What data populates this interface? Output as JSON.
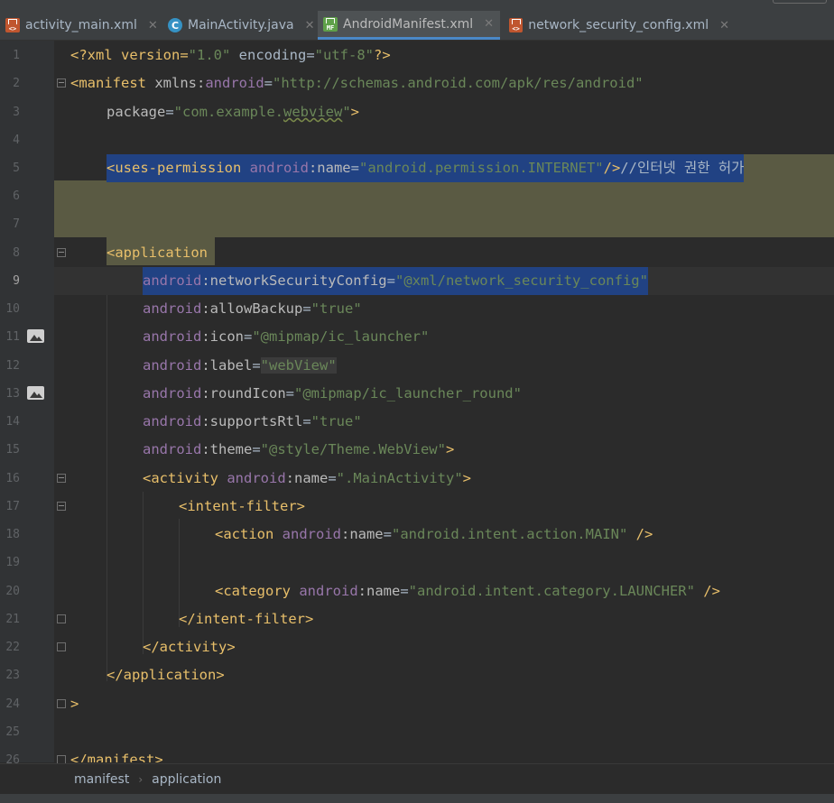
{
  "tabs": [
    {
      "label": "activity_main.xml",
      "icon": "xml-file-icon"
    },
    {
      "label": "MainActivity.java",
      "icon": "java-class-icon"
    },
    {
      "label": "AndroidManifest.xml",
      "icon": "manifest-file-icon",
      "active": true
    },
    {
      "label": "network_security_config.xml",
      "icon": "xml-file-icon"
    }
  ],
  "gutter": {
    "line_numbers": [
      "1",
      "2",
      "3",
      "4",
      "5",
      "6",
      "7",
      "8",
      "9",
      "10",
      "11",
      "12",
      "13",
      "14",
      "15",
      "16",
      "17",
      "18",
      "19",
      "20",
      "21",
      "22",
      "23",
      "24",
      "25",
      "26"
    ],
    "current_line": "9"
  },
  "code": {
    "l1": {
      "a": "<?xml version=",
      "b": "\"1.0\"",
      "c": " encoding=",
      "d": "\"utf-8\"",
      "e": "?>"
    },
    "l2": {
      "a": "<manifest ",
      "b": "xmlns",
      "c": ":",
      "d": "android",
      "e": "=",
      "f": "\"http://schemas.android.com/apk/res/android\""
    },
    "l3": {
      "a": "package",
      "b": "=",
      "c": "\"com.example.",
      "d": "webview",
      "e": "\"",
      "f": ">"
    },
    "l5": {
      "a": "<uses-permission ",
      "b": "android",
      "c": ":name",
      "d": "=",
      "e": "\"android.permission.INTERNET\"",
      "f": "/>",
      "g": "//인터넷 권한 허가"
    },
    "l8": {
      "a": "<application"
    },
    "l9": {
      "a": "android",
      "b": ":networkSecurityConfig",
      "c": "=",
      "d": "\"@xml/network_security_config\""
    },
    "l10": {
      "a": "android",
      "b": ":allowBackup",
      "c": "=",
      "d": "\"true\""
    },
    "l11": {
      "a": "android",
      "b": ":icon",
      "c": "=",
      "d": "\"@mipmap/ic_launcher\""
    },
    "l12": {
      "a": "android",
      "b": ":label",
      "c": "=",
      "d": "\"webView\""
    },
    "l13": {
      "a": "android",
      "b": ":roundIcon",
      "c": "=",
      "d": "\"@mipmap/ic_launcher_round\""
    },
    "l14": {
      "a": "android",
      "b": ":supportsRtl",
      "c": "=",
      "d": "\"true\""
    },
    "l15": {
      "a": "android",
      "b": ":theme",
      "c": "=",
      "d": "\"@style/Theme.WebView\"",
      "e": ">"
    },
    "l16": {
      "a": "<activity ",
      "b": "android",
      "c": ":name",
      "d": "=",
      "e": "\".MainActivity\"",
      "f": ">"
    },
    "l17": {
      "a": "<intent-filter>"
    },
    "l18": {
      "a": "<action ",
      "b": "android",
      "c": ":name",
      "d": "=",
      "e": "\"android.intent.action.MAIN\"",
      "f": " />"
    },
    "l20": {
      "a": "<category ",
      "b": "android",
      "c": ":name",
      "d": "=",
      "e": "\"android.intent.category.LAUNCHER\"",
      "f": " />"
    },
    "l21": {
      "a": "</intent-filter>"
    },
    "l22": {
      "a": "</activity>"
    },
    "l23": {
      "a": "</application>"
    },
    "l24": {
      "a": ">"
    },
    "l26": {
      "a": "</manifest>"
    }
  },
  "breadcrumb": {
    "items": [
      "manifest",
      "application"
    ]
  },
  "colors": {
    "background": "#2b2b2b",
    "selection": "#214283",
    "tag": "#e8bf6a",
    "namespace": "#9876aa",
    "string": "#6a8759"
  }
}
